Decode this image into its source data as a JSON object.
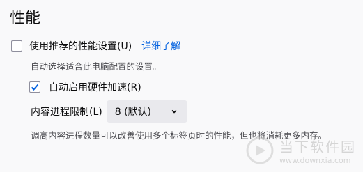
{
  "section": {
    "title": "性能"
  },
  "recommended": {
    "label": "使用推荐的性能设置(U)",
    "learn_more": "详细了解",
    "checked": false,
    "hint": "自动选择适合此电脑配置的设置。"
  },
  "hardware_accel": {
    "label": "自动启用硬件加速(R)",
    "checked": true
  },
  "process_limit": {
    "label": "内容进程限制(L)",
    "selected": "8 (默认)",
    "hint": "调高内容进程数量可以改善使用多个标签页时的性能，但也将消耗更多内存。"
  },
  "watermark": {
    "brand_cn": "当下软件园",
    "url": "www.downxia.com"
  },
  "colors": {
    "accent": "#0060df",
    "background": "#f9f9fa"
  }
}
